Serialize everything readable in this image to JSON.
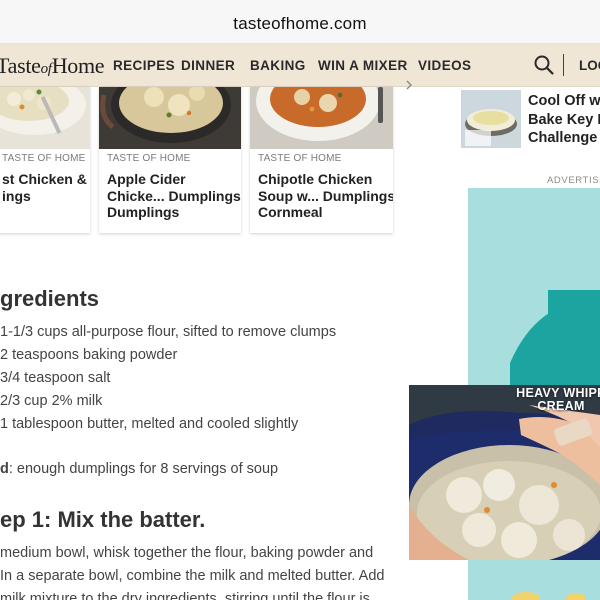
{
  "browser": {
    "url": "tasteofhome.com"
  },
  "nav": {
    "logo_part1": "Taste",
    "logo_of": "of",
    "logo_part2": "Home",
    "items": [
      "RECIPES",
      "DINNER",
      "BAKING",
      "WIN A MIXER",
      "VIDEOS"
    ],
    "login": "LOG"
  },
  "cards": [
    {
      "source": "TASTE OF HOME",
      "title_lines": [
        "st Chicken &",
        "ings"
      ]
    },
    {
      "source": "TASTE OF HOME",
      "title_lines": [
        "Apple Cider",
        "Chicke... Dumplings",
        "Dumplings"
      ]
    },
    {
      "source": "TASTE OF HOME",
      "title_lines": [
        "Chipotle Chicken",
        "Soup w... Dumplings",
        "Cornmeal"
      ]
    }
  ],
  "rail": {
    "title_lines": [
      "Cool Off wi",
      "Bake Key L",
      "Challenge"
    ]
  },
  "ad": {
    "label": "ADVERTISEM"
  },
  "video": {
    "caption_line1": "HEAVY WHIPP",
    "caption_line2": "CREAM"
  },
  "article": {
    "ingredients_heading": "gredients",
    "ingredients": [
      "1-1/3 cups all-purpose flour, sifted to remove clumps",
      "2 teaspoons baking powder",
      "3/4 teaspoon salt",
      "2/3 cup 2% milk",
      "1 tablespoon butter, melted and cooled slightly"
    ],
    "yield_label": "d",
    "yield_text": ": enough dumplings for 8 servings of soup",
    "step_heading": "ep 1: Mix the batter.",
    "step_lines": [
      "medium bowl, whisk together the flour, baking powder and",
      "In a separate bowl, combine the milk and melted butter. Add",
      "milk mixture to the dry ingredients, stirring until the flour is"
    ]
  }
}
